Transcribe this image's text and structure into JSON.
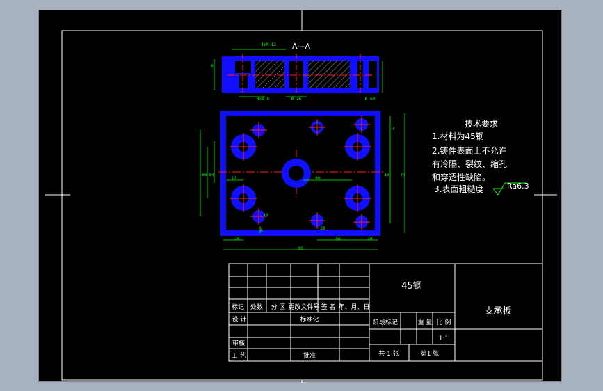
{
  "drawing": {
    "section_label": "A—A",
    "tech_requirements": {
      "title": "技术要求",
      "items": [
        "1.材料为45钢",
        "2.铸件表面上不允许",
        "有冷隔、裂纹、缩孔",
        "和穿透性缺陷。",
        "3.表面粗糙度"
      ],
      "roughness": "Ra6.3"
    },
    "dimensions": {
      "top_view": [
        "4xM 12",
        "4xØ 8",
        "Ø 16",
        "8",
        "Ø 60"
      ],
      "plan_view": [
        "90",
        "70",
        "54",
        "12",
        "60",
        "16",
        "60",
        "10",
        "6",
        "4",
        "56",
        "28",
        "10",
        "10"
      ]
    }
  },
  "title_block": {
    "material": "45钢",
    "part_name": "支承板",
    "scale": "1:1",
    "headers": [
      "标记",
      "处数",
      "分 区",
      "更改文件号",
      "签 名",
      "年、月、日"
    ],
    "labels": {
      "design": "设 计",
      "standardize": "标准化",
      "stage_mark": "阶段标记",
      "weight": "重 量",
      "ratio": "比 例",
      "review": "审核",
      "process": "工 艺",
      "approve": "批准",
      "total_sheets": "共 1  张",
      "sheet_no": "第1  张"
    }
  },
  "colors": {
    "background": "#a9b2bf",
    "paper": "#000000",
    "part": "#1010ff",
    "centerline": "#ff2020",
    "dimension": "#00ff00",
    "text": "#ffffff"
  }
}
